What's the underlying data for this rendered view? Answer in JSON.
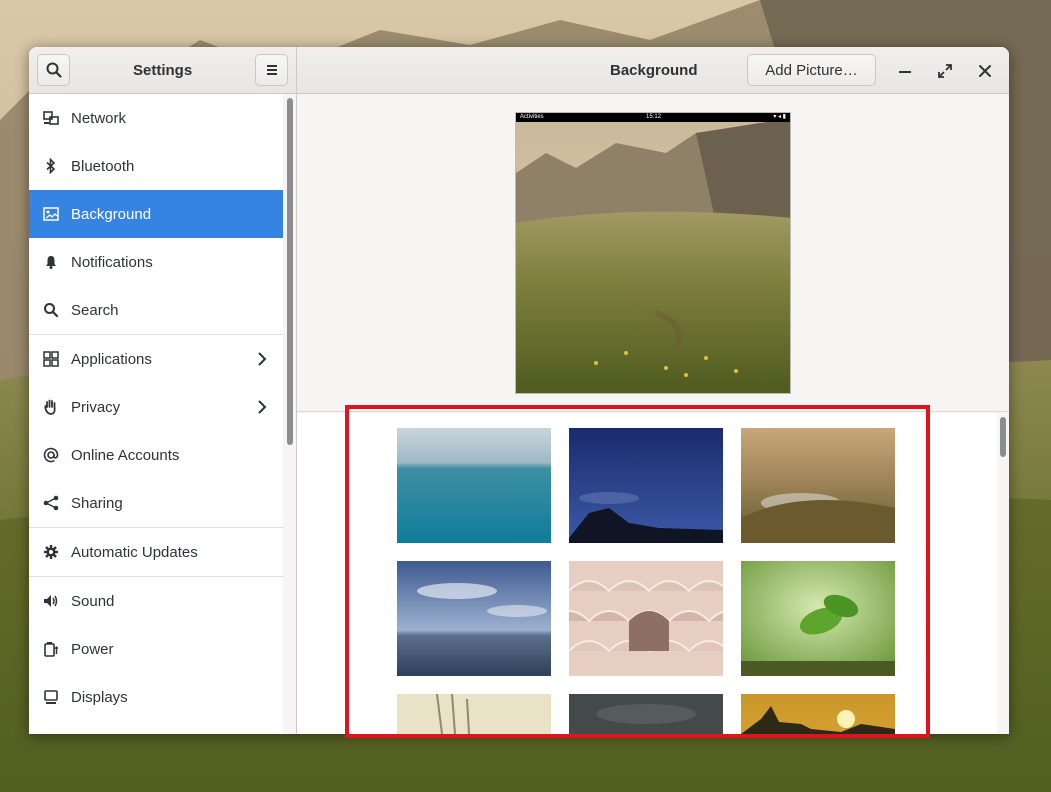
{
  "headerbar": {
    "sidebar_title": "Settings",
    "page_title": "Background",
    "add_picture_label": "Add Picture…"
  },
  "sidebar": {
    "items": [
      {
        "label": "Network",
        "icon": "network-icon"
      },
      {
        "label": "Bluetooth",
        "icon": "bluetooth-icon"
      },
      {
        "label": "Background",
        "icon": "background-icon",
        "active": true
      },
      {
        "label": "Notifications",
        "icon": "bell-icon"
      },
      {
        "label": "Search",
        "icon": "search-icon"
      },
      {
        "label": "Applications",
        "icon": "apps-grid-icon",
        "has_submenu": true
      },
      {
        "label": "Privacy",
        "icon": "hand-icon",
        "has_submenu": true
      },
      {
        "label": "Online Accounts",
        "icon": "at-icon"
      },
      {
        "label": "Sharing",
        "icon": "share-icon"
      },
      {
        "label": "Automatic Updates",
        "icon": "gear-icon"
      },
      {
        "label": "Sound",
        "icon": "speaker-icon"
      },
      {
        "label": "Power",
        "icon": "power-icon"
      },
      {
        "label": "Displays",
        "icon": "display-icon"
      }
    ]
  },
  "preview": {
    "topbar_left": "Activities",
    "topbar_clock": "15:12"
  },
  "gallery": {
    "thumbnails": [
      {
        "name": "wallpaper-ocean-teal"
      },
      {
        "name": "wallpaper-night-sky"
      },
      {
        "name": "wallpaper-valley-sunset"
      },
      {
        "name": "wallpaper-sea-clouds"
      },
      {
        "name": "wallpaper-pastel-tiles"
      },
      {
        "name": "wallpaper-green-leaves"
      },
      {
        "name": "wallpaper-grass-light"
      },
      {
        "name": "wallpaper-dark-blur"
      },
      {
        "name": "wallpaper-sunset-trees"
      }
    ]
  },
  "colors": {
    "accent": "#3584e4",
    "annotation": "#e0141e"
  }
}
